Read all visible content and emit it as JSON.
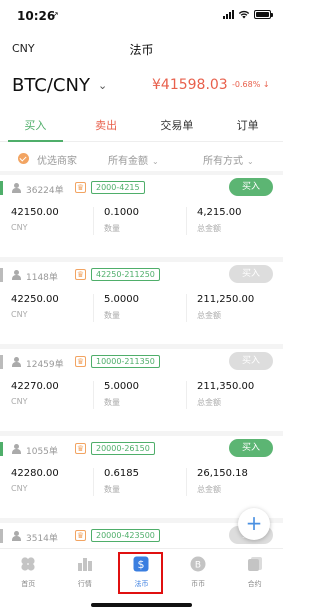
{
  "status_bar": {
    "time": "10:26",
    "location_arrow": "↗"
  },
  "header": {
    "currency": "CNY",
    "title": "法币"
  },
  "pair": {
    "name": "BTC/CNY",
    "caret": "⌄",
    "price": "¥41598.03",
    "change": "-0.68% ↓"
  },
  "tabs": [
    {
      "label": "买入"
    },
    {
      "label": "卖出"
    },
    {
      "label": "交易单"
    },
    {
      "label": "订单"
    }
  ],
  "filter": {
    "merchant": "优选商家",
    "amount": "所有金额",
    "method": "所有方式",
    "chevron": "⌄"
  },
  "cards": [
    {
      "orders": "36224单",
      "range": "2000-4215",
      "action": "买入",
      "enabled": true,
      "price": "42150.00",
      "price_label": "CNY",
      "qty": "0.1000",
      "qty_label": "数量",
      "total": "4,215.00",
      "total_label": "总金额"
    },
    {
      "orders": "1148单",
      "range": "42250-211250",
      "action": "买入",
      "enabled": false,
      "price": "42250.00",
      "price_label": "CNY",
      "qty": "5.0000",
      "qty_label": "数量",
      "total": "211,250.00",
      "total_label": "总金额"
    },
    {
      "orders": "12459单",
      "range": "10000-211350",
      "action": "买入",
      "enabled": false,
      "price": "42270.00",
      "price_label": "CNY",
      "qty": "5.0000",
      "qty_label": "数量",
      "total": "211,350.00",
      "total_label": "总金额"
    },
    {
      "orders": "1055单",
      "range": "20000-26150",
      "action": "买入",
      "enabled": true,
      "price": "42280.00",
      "price_label": "CNY",
      "qty": "0.6185",
      "qty_label": "数量",
      "total": "26,150.18",
      "total_label": "总金额"
    },
    {
      "orders": "3514单",
      "range": "20000-423500",
      "action": "买入",
      "enabled": false,
      "price": "",
      "price_label": "",
      "qty": "",
      "qty_label": "",
      "total": "",
      "total_label": ""
    }
  ],
  "crown_glyph": "♛",
  "fab": {
    "symbol": "+"
  },
  "bottom_nav": [
    {
      "label": "首页",
      "icon": "home-icon"
    },
    {
      "label": "行情",
      "icon": "market-icon"
    },
    {
      "label": "法币",
      "icon": "fiat-icon",
      "active": true
    },
    {
      "label": "币币",
      "icon": "coin-icon"
    },
    {
      "label": "合约",
      "icon": "contract-icon"
    }
  ],
  "colors": {
    "green": "#4fae6a",
    "red": "#e8604c",
    "orange": "#f2a462",
    "blue": "#3a7ee0",
    "highlight": "#e01010"
  }
}
